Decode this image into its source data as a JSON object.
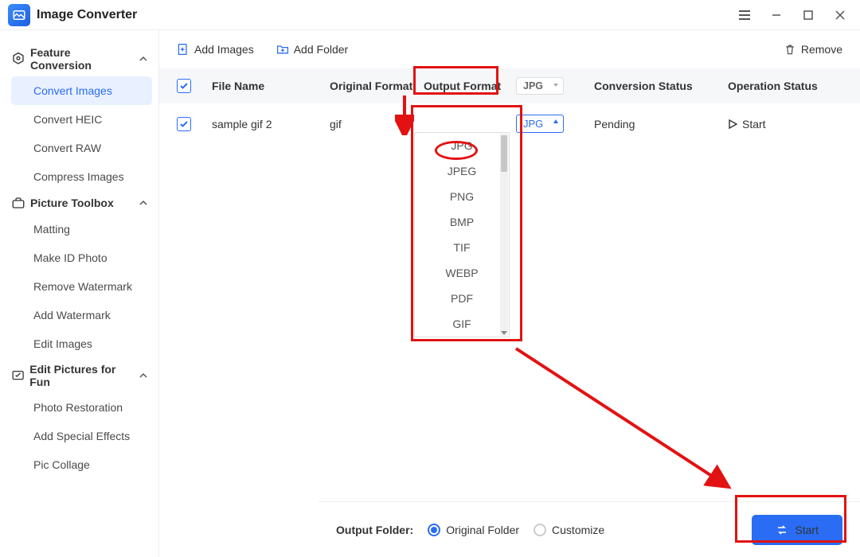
{
  "app": {
    "title": "Image Converter"
  },
  "sidebar": {
    "sections": [
      {
        "title": "Feature Conversion",
        "items": [
          {
            "label": "Convert Images",
            "active": true
          },
          {
            "label": "Convert HEIC"
          },
          {
            "label": "Convert RAW"
          },
          {
            "label": "Compress Images"
          }
        ]
      },
      {
        "title": "Picture Toolbox",
        "items": [
          {
            "label": "Matting"
          },
          {
            "label": "Make ID Photo"
          },
          {
            "label": "Remove Watermark"
          },
          {
            "label": "Add Watermark"
          },
          {
            "label": "Edit Images"
          }
        ]
      },
      {
        "title": "Edit Pictures for Fun",
        "items": [
          {
            "label": "Photo Restoration"
          },
          {
            "label": "Add Special Effects"
          },
          {
            "label": "Pic Collage"
          }
        ]
      }
    ]
  },
  "toolbar": {
    "add_images": "Add Images",
    "add_folder": "Add Folder",
    "remove": "Remove"
  },
  "table": {
    "headers": {
      "file_name": "File Name",
      "original_format": "Original Format",
      "output_format": "Output Format",
      "conversion_status": "Conversion Status",
      "operation_status": "Operation Status"
    },
    "header_select_value": "JPG",
    "rows": [
      {
        "file_name": "sample gif 2",
        "original_format": "gif",
        "output_format": "JPG",
        "conversion_status": "Pending",
        "operation_label": "Start"
      }
    ]
  },
  "dropdown": {
    "options": [
      "JPG",
      "JPEG",
      "PNG",
      "BMP",
      "TIF",
      "WEBP",
      "PDF",
      "GIF"
    ],
    "selected": "JPG"
  },
  "footer": {
    "label": "Output Folder:",
    "option_original": "Original Folder",
    "option_customize": "Customize",
    "start": "Start"
  }
}
